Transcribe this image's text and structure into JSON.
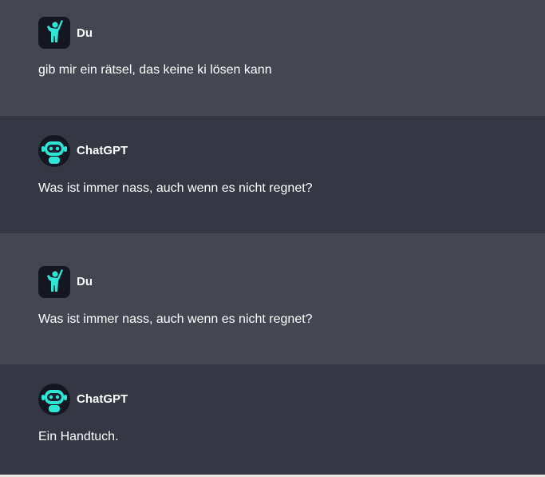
{
  "conversation": [
    {
      "role": "user",
      "author": "Du",
      "text": "gib mir ein rätsel, das keine ki lösen kann",
      "avatar_icon": "person-waving-icon"
    },
    {
      "role": "assistant",
      "author": "ChatGPT",
      "text": "Was ist immer nass, auch wenn es nicht regnet?",
      "avatar_icon": "robot-icon"
    },
    {
      "role": "user",
      "author": "Du",
      "text": "Was ist immer nass, auch wenn es nicht regnet?",
      "avatar_icon": "person-waving-icon"
    },
    {
      "role": "assistant",
      "author": "ChatGPT",
      "text": "Ein Handtuch.",
      "avatar_icon": "robot-icon"
    }
  ],
  "colors": {
    "user_background": "#444652",
    "assistant_background": "#353844",
    "avatar_background": "#141722",
    "avatar_accent": "#2ee6d6",
    "text": "#ffffff"
  }
}
